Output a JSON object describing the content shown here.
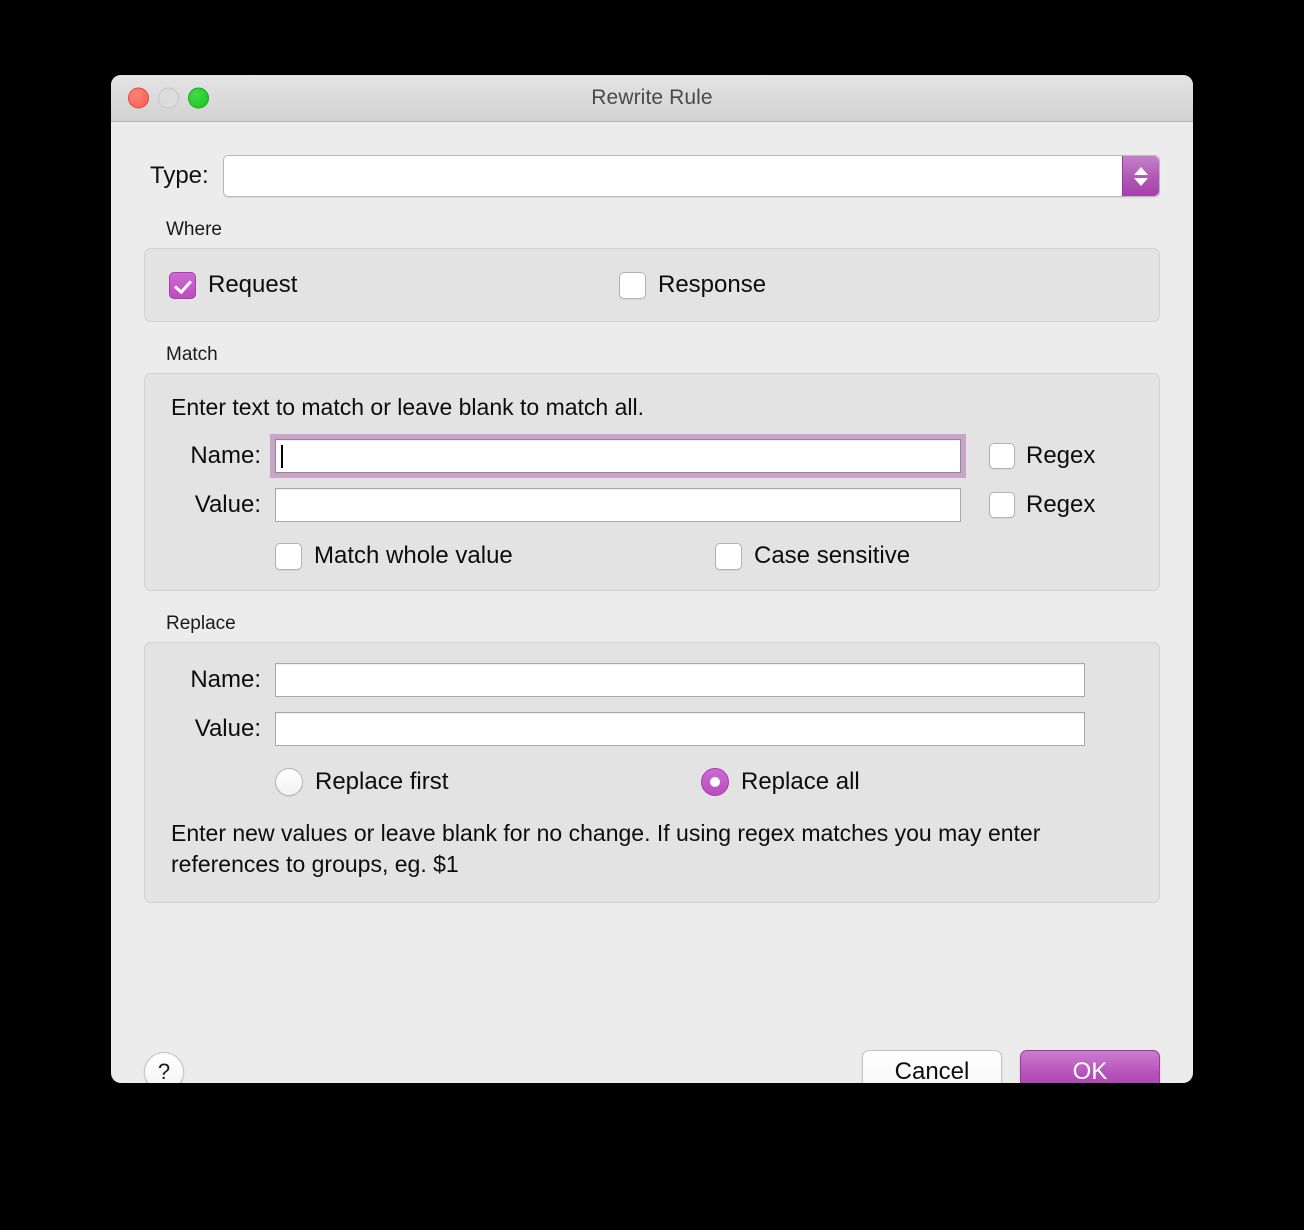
{
  "window": {
    "title": "Rewrite Rule",
    "traffic_lights": [
      "close-button",
      "minimize-button",
      "zoom-button"
    ]
  },
  "type_row": {
    "label": "Type:",
    "value": "",
    "placeholder": ""
  },
  "where": {
    "group_title": "Where",
    "request": {
      "label": "Request",
      "checked": true
    },
    "response": {
      "label": "Response",
      "checked": false
    }
  },
  "match": {
    "group_title": "Match",
    "hint": "Enter text to match or leave blank to match all.",
    "name": {
      "label": "Name:",
      "value": "",
      "focused": true
    },
    "name_regex": {
      "label": "Regex",
      "checked": false
    },
    "value": {
      "label": "Value:",
      "value": "",
      "focused": false
    },
    "value_regex": {
      "label": "Regex",
      "checked": false
    },
    "match_whole_value": {
      "label": "Match whole value",
      "checked": false
    },
    "case_sensitive": {
      "label": "Case sensitive",
      "checked": false
    }
  },
  "replace": {
    "group_title": "Replace",
    "name": {
      "label": "Name:",
      "value": ""
    },
    "value": {
      "label": "Value:",
      "value": ""
    },
    "replace_first": {
      "label": "Replace first",
      "selected": false
    },
    "replace_all": {
      "label": "Replace all",
      "selected": true
    },
    "note": "Enter new values or leave blank for no change. If using regex matches you may enter references to groups, eg. $1"
  },
  "footer": {
    "help_label": "?",
    "cancel_label": "Cancel",
    "ok_label": "OK"
  },
  "colors": {
    "accent": "#bd4cc0",
    "accent_dark": "#a63fae",
    "focus_ring": "#c8a4ca",
    "window_bg": "#ececec",
    "group_bg": "#e3e3e3"
  }
}
